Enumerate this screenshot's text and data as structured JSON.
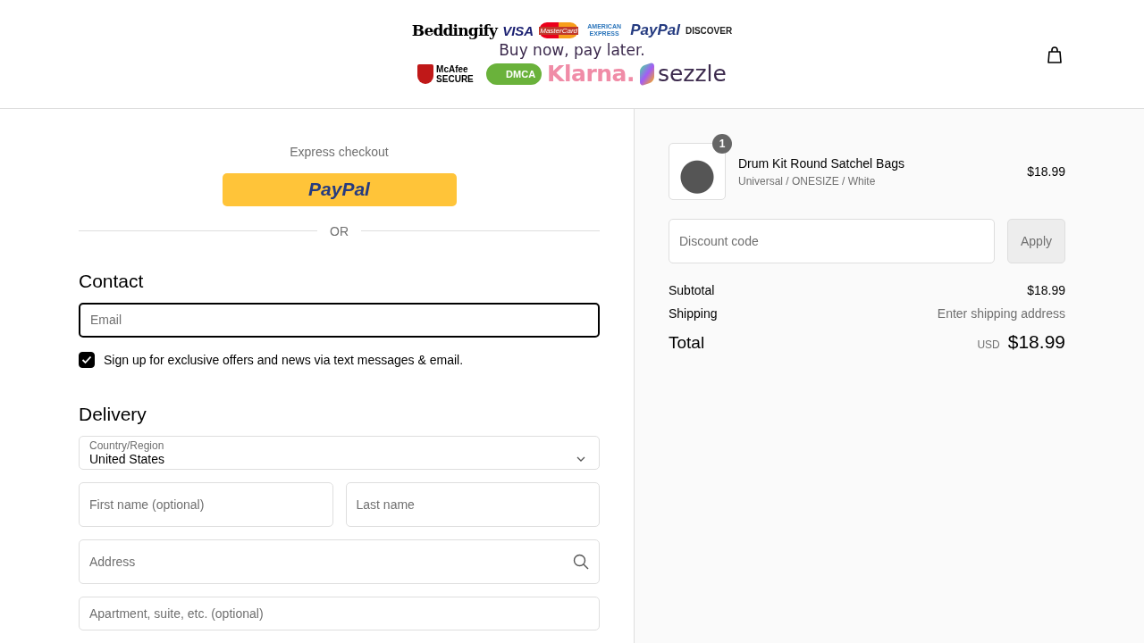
{
  "header": {
    "brand": "Beddingify",
    "cards": [
      {
        "kind": "visa",
        "text": "VISA"
      },
      {
        "kind": "mastercard",
        "text": "MasterCard"
      },
      {
        "kind": "amex",
        "text": "AMERICAN EXPRESS"
      },
      {
        "kind": "paypal",
        "text": "PayPal"
      },
      {
        "kind": "discover",
        "text": "DISCOVER"
      }
    ],
    "tagline": "Buy now, pay later.",
    "badges": [
      {
        "kind": "mcafee",
        "text": "McAfee SECURE"
      },
      {
        "kind": "dmca",
        "text": "DMCA"
      },
      {
        "kind": "klarna",
        "text": "Klarna."
      },
      {
        "kind": "sezzle",
        "text": "sezzle"
      }
    ]
  },
  "express": {
    "title": "Express checkout",
    "paypal_button": "PayPal",
    "divider": "OR"
  },
  "contact": {
    "heading": "Contact",
    "email": {
      "placeholder": "Email",
      "focused": true
    },
    "signup": {
      "label": "Sign up for exclusive offers and news via text messages & email.",
      "checked": true
    }
  },
  "delivery": {
    "heading": "Delivery",
    "country": {
      "label": "Country/Region",
      "value": "United States"
    },
    "first_name": {
      "placeholder": "First name (optional)"
    },
    "last_name": {
      "placeholder": "Last name"
    },
    "address": {
      "placeholder": "Address"
    },
    "apartment": {
      "placeholder": "Apartment, suite, etc. (optional)"
    }
  },
  "summary": {
    "item": {
      "quantity": "1",
      "name": "Drum Kit Round Satchel Bags",
      "variant": "Universal / ONESIZE / White",
      "price": "$18.99"
    },
    "discount": {
      "placeholder": "Discount code",
      "button": "Apply"
    },
    "subtotal": {
      "label": "Subtotal",
      "value": "$18.99"
    },
    "shipping": {
      "label": "Shipping",
      "value": "Enter shipping address"
    },
    "total": {
      "label": "Total",
      "currency": "USD",
      "value": "$18.99"
    }
  }
}
